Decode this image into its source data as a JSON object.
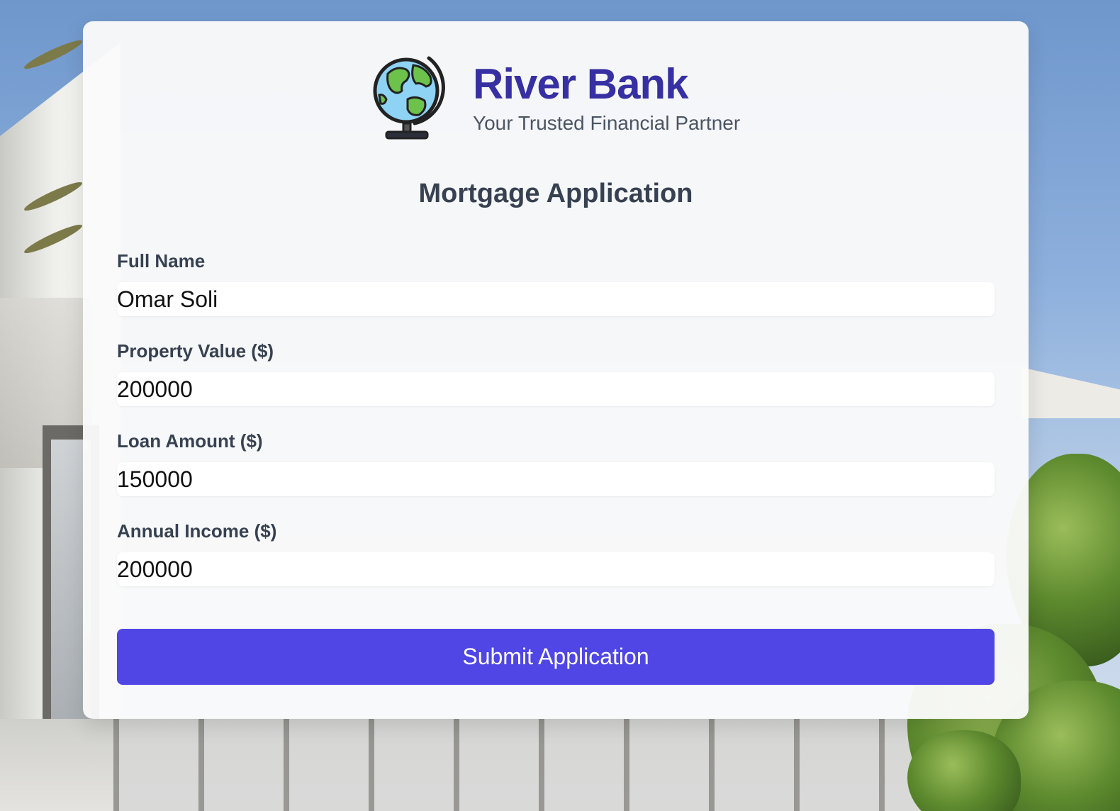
{
  "brand": {
    "name": "River Bank",
    "tagline": "Your Trusted Financial Partner",
    "logo_icon": "globe-icon"
  },
  "form": {
    "title": "Mortgage Application",
    "fields": [
      {
        "label": "Full Name",
        "value": "Omar Soli"
      },
      {
        "label": "Property Value ($)",
        "value": "200000"
      },
      {
        "label": "Loan Amount ($)",
        "value": "150000"
      },
      {
        "label": "Annual Income ($)",
        "value": "200000"
      }
    ],
    "submit_label": "Submit Application"
  },
  "colors": {
    "brand_text": "#3730a3",
    "button": "#4f46e5",
    "heading": "#374151"
  }
}
